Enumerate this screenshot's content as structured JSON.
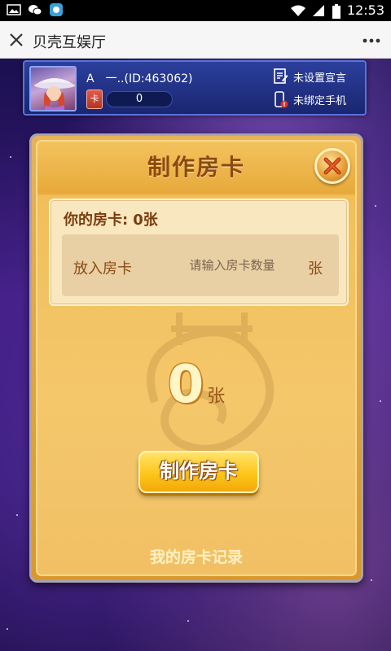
{
  "status_bar": {
    "time": "12:53",
    "left_icons": [
      "image-icon",
      "wechat-icon",
      "app-icon"
    ],
    "right_icons": [
      "wifi-icon",
      "signal-icon",
      "battery-icon"
    ]
  },
  "title_bar": {
    "title": "贝壳互娱厅",
    "close_icon": "close-icon",
    "more_icon": "more-icon"
  },
  "profile": {
    "name": "A　一..(ID:463062)",
    "card_label": "卡",
    "card_count": "0",
    "declaration_link": "未设置宣言",
    "phone_link": "未绑定手机"
  },
  "dialog": {
    "title": "制作房卡",
    "owned_label": "你的房卡:",
    "owned_value": "0张",
    "input_label": "放入房卡",
    "input_placeholder": "请输入房卡数量",
    "input_value": "",
    "input_unit": "张",
    "big_count": "0",
    "big_unit": "张",
    "make_button": "制作房卡",
    "records_link": "我的房卡记录"
  },
  "colors": {
    "dialog_gold": "#f1c065",
    "title_brown": "#8b4a12",
    "button_yellow": "#ffc61a",
    "profile_blue": "#1a2670"
  }
}
